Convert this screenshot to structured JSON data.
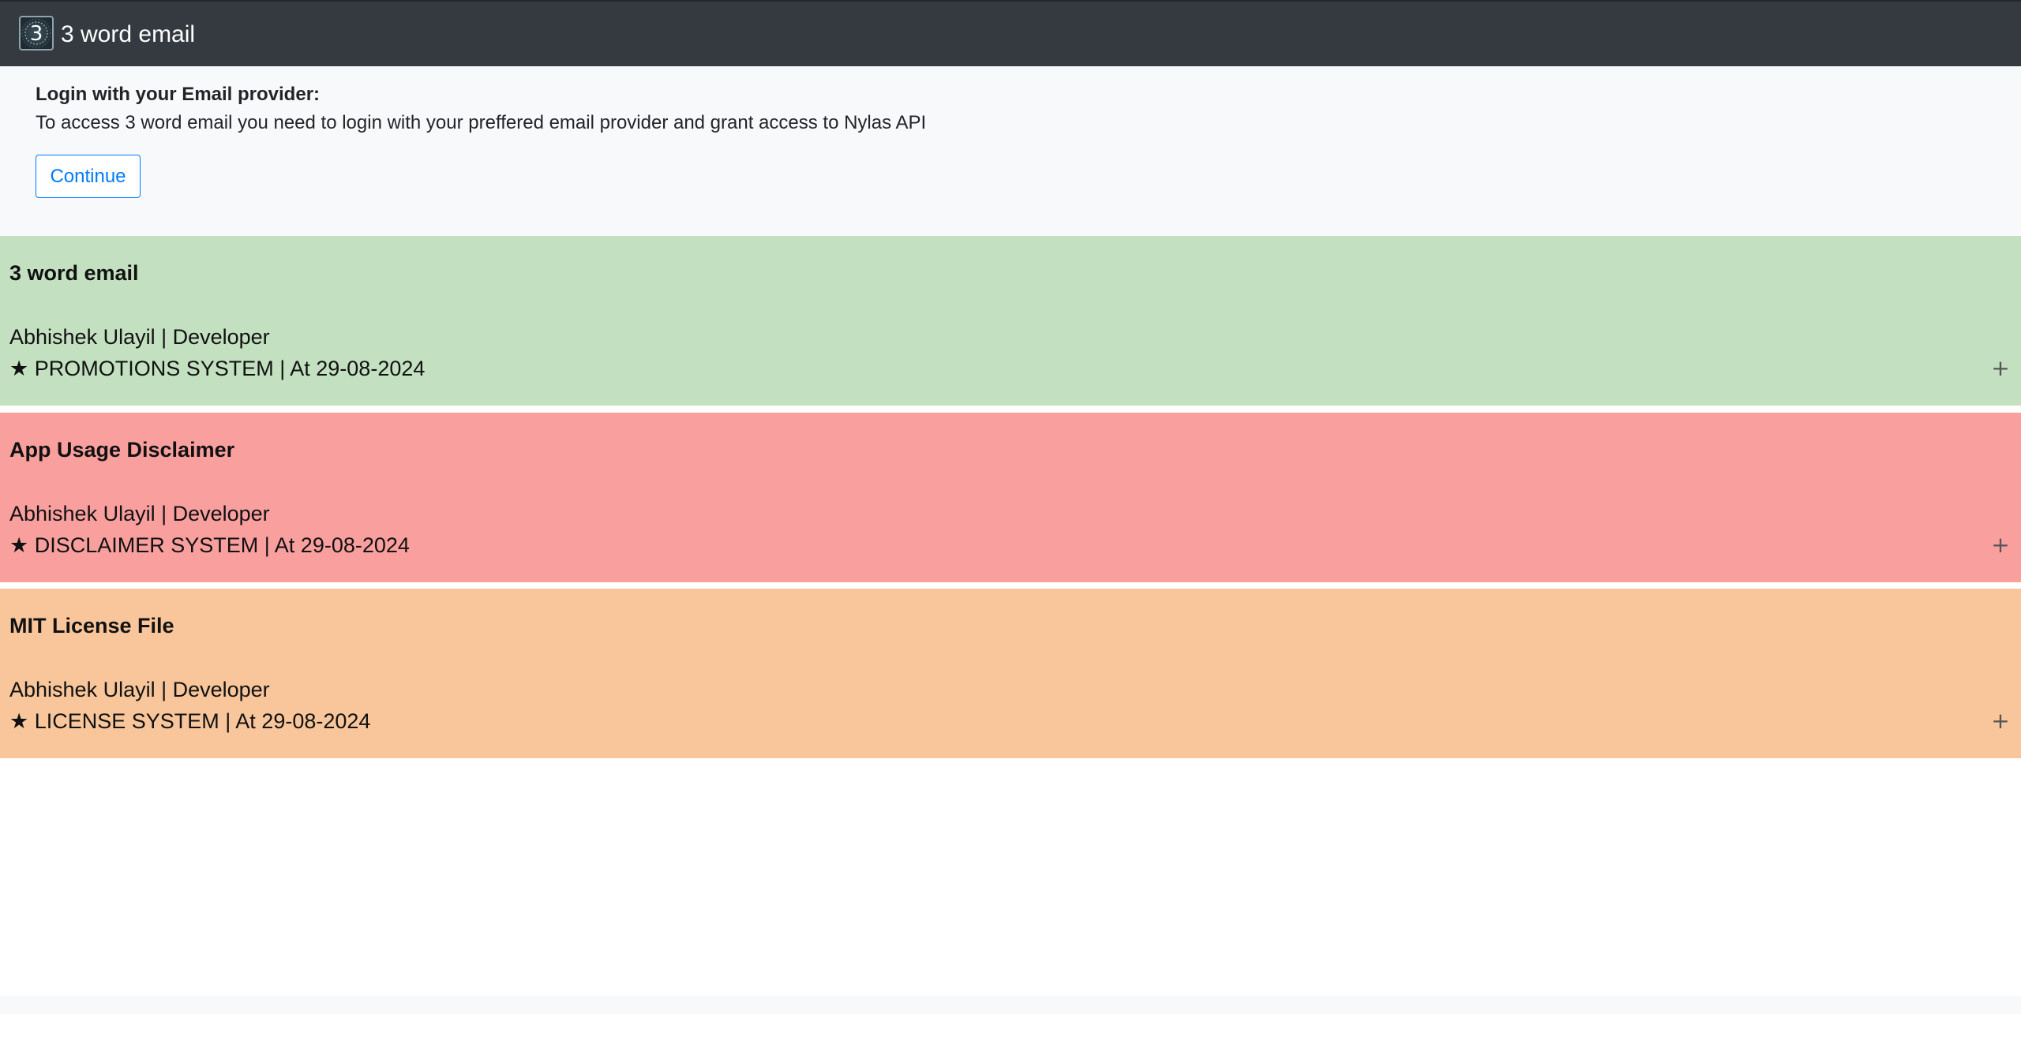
{
  "navbar": {
    "logo_icon": "number-3-logo",
    "logo_glyph": "3",
    "title": "3 word email"
  },
  "login": {
    "heading": "Login with your Email provider:",
    "description": "To access 3 word email you need to login with your preffered email provider and grant access to Nylas API",
    "continue_label": "Continue"
  },
  "emails": [
    {
      "title": "3 word email",
      "author": "Abhishek Ulayil | Developer",
      "meta": "★ PROMOTIONS SYSTEM | At 29-08-2024",
      "color": "#c3e1c0",
      "expand_icon": "+"
    },
    {
      "title": "App Usage Disclaimer",
      "author": "Abhishek Ulayil | Developer",
      "meta": "★ DISCLAIMER SYSTEM | At 29-08-2024",
      "color": "#f9a09f",
      "expand_icon": "+"
    },
    {
      "title": "MIT License File",
      "author": "Abhishek Ulayil | Developer",
      "meta": "★ LICENSE SYSTEM | At 29-08-2024",
      "color": "#f8c69a",
      "expand_icon": "+"
    }
  ]
}
